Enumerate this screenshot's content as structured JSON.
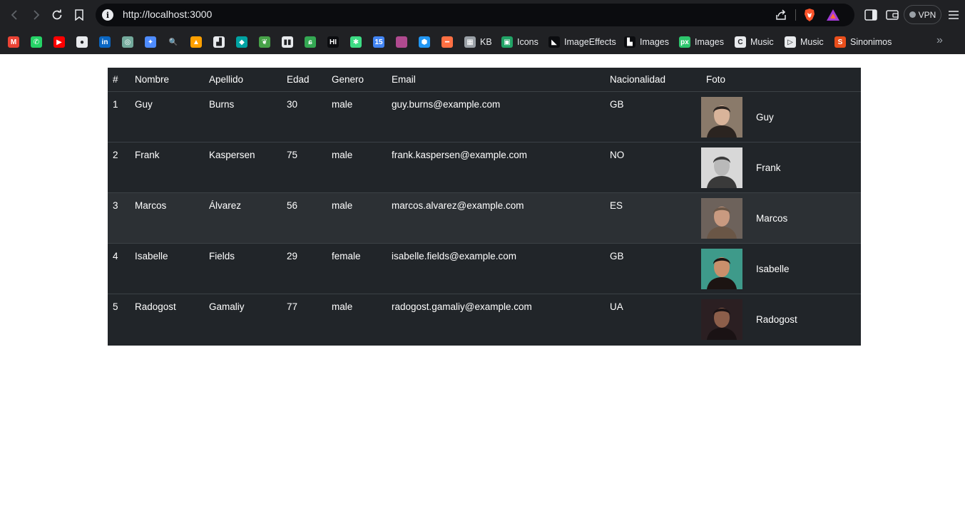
{
  "browser": {
    "url": "http://localhost:3000",
    "vpn_label": "VPN",
    "bookmarks": [
      {
        "label": "",
        "icon": "gmail-icon",
        "color": "#ea4335",
        "glyph": "M"
      },
      {
        "label": "",
        "icon": "whatsapp-icon",
        "color": "#25d366",
        "glyph": "✆"
      },
      {
        "label": "",
        "icon": "youtube-icon",
        "color": "#ff0000",
        "glyph": "▶"
      },
      {
        "label": "",
        "icon": "github-icon",
        "color": "#e8eaed",
        "glyph": "●"
      },
      {
        "label": "",
        "icon": "linkedin-icon",
        "color": "#0a66c2",
        "glyph": "in"
      },
      {
        "label": "",
        "icon": "chatgpt-icon",
        "color": "#74aa9c",
        "glyph": "◎"
      },
      {
        "label": "",
        "icon": "gemini-icon",
        "color": "#4e8cff",
        "glyph": "✦"
      },
      {
        "label": "",
        "icon": "search-bookmark-icon",
        "color": "#202124",
        "glyph": "🔍"
      },
      {
        "label": "",
        "icon": "firebase-icon",
        "color": "#ffa000",
        "glyph": "▲"
      },
      {
        "label": "",
        "icon": "pipe-icon",
        "color": "#e8eaed",
        "glyph": "▟"
      },
      {
        "label": "",
        "icon": "diamond-icon",
        "color": "#00a3a3",
        "glyph": "◆"
      },
      {
        "label": "",
        "icon": "mongodb-icon",
        "color": "#47a248",
        "glyph": "❦"
      },
      {
        "label": "",
        "icon": "trello-icon",
        "color": "#e8eaed",
        "glyph": "▮▮"
      },
      {
        "label": "",
        "icon": "swirl-icon",
        "color": "#34a853",
        "glyph": "ɕ"
      },
      {
        "label": "",
        "icon": "hi-icon",
        "color": "#0b0c0f",
        "glyph": "HI"
      },
      {
        "label": "",
        "icon": "asterisk-icon",
        "color": "#3ddc84",
        "glyph": "✱"
      },
      {
        "label": "",
        "icon": "calendar-icon",
        "color": "#4285f4",
        "glyph": "15"
      },
      {
        "label": "",
        "icon": "gradient-icon",
        "color": "#b04a8f",
        "glyph": ""
      },
      {
        "label": "",
        "icon": "cube-icon",
        "color": "#2196f3",
        "glyph": "⬢"
      },
      {
        "label": "",
        "icon": "rainbow-icon",
        "color": "#ff7043",
        "glyph": "━"
      },
      {
        "label": "KB",
        "icon": "kb-icon",
        "color": "#9aa0a6",
        "glyph": "▦"
      },
      {
        "label": "Icons",
        "icon": "icons-icon",
        "color": "#21a366",
        "glyph": "▣"
      },
      {
        "label": "ImageEffects",
        "icon": "image-effects-icon",
        "color": "#0b0c0f",
        "glyph": "◣"
      },
      {
        "label": "Images",
        "icon": "unsplash-icon",
        "color": "#0b0c0f",
        "glyph": "▙"
      },
      {
        "label": "Images",
        "icon": "pixabay-icon",
        "color": "#2ec66d",
        "glyph": "px"
      },
      {
        "label": "Music",
        "icon": "music-c-icon",
        "color": "#e8eaed",
        "glyph": "C"
      },
      {
        "label": "Music",
        "icon": "music-play-icon",
        "color": "#e8eaed",
        "glyph": "▷"
      },
      {
        "label": "Sinonimos",
        "icon": "sinonimos-icon",
        "color": "#e94e1b",
        "glyph": "S"
      }
    ]
  },
  "table": {
    "headers": [
      "#",
      "Nombre",
      "Apellido",
      "Edad",
      "Genero",
      "Email",
      "Nacionalidad",
      "Foto"
    ],
    "rows": [
      {
        "n": "1",
        "nombre": "Guy",
        "apellido": "Burns",
        "edad": "30",
        "genero": "male",
        "email": "guy.burns@example.com",
        "nac": "GB",
        "foto_name": "Guy",
        "photo_bg": "#8a7a6a",
        "skin": "#d9b49a",
        "hair": "#2b2420"
      },
      {
        "n": "2",
        "nombre": "Frank",
        "apellido": "Kaspersen",
        "edad": "75",
        "genero": "male",
        "email": "frank.kaspersen@example.com",
        "nac": "NO",
        "foto_name": "Frank",
        "photo_bg": "#d8d8d8",
        "skin": "#b9b9b9",
        "hair": "#3a3a3a"
      },
      {
        "n": "3",
        "nombre": "Marcos",
        "apellido": "Álvarez",
        "edad": "56",
        "genero": "male",
        "email": "marcos.alvarez@example.com",
        "nac": "ES",
        "foto_name": "Marcos",
        "photo_bg": "#6d625b",
        "skin": "#c99a80",
        "hair": "#6a5646"
      },
      {
        "n": "4",
        "nombre": "Isabelle",
        "apellido": "Fields",
        "edad": "29",
        "genero": "female",
        "email": "isabelle.fields@example.com",
        "nac": "GB",
        "foto_name": "Isabelle",
        "photo_bg": "#3e9a8a",
        "skin": "#c98f6b",
        "hair": "#1c1412"
      },
      {
        "n": "5",
        "nombre": "Radogost",
        "apellido": "Gamaliy",
        "edad": "77",
        "genero": "male",
        "email": "radogost.gamaliy@example.com",
        "nac": "UA",
        "foto_name": "Radogost",
        "photo_bg": "#2b1f22",
        "skin": "#8c5e4a",
        "hair": "#1a1214"
      }
    ]
  }
}
